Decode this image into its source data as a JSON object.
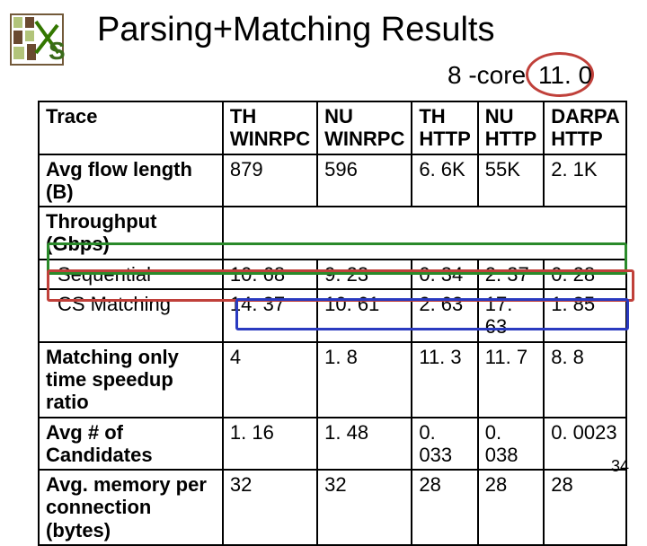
{
  "title": "Parsing+Matching Results",
  "subtitle_left": "8 -core",
  "subtitle_right": "11. 0",
  "headers": {
    "trace": "Trace",
    "c1": "TH WINRPC",
    "c2": "NU WINRPC",
    "c3": "TH HTTP",
    "c4": "NU HTTP",
    "c5": "DARPA HTTP"
  },
  "rows": {
    "avgflow": {
      "label": "Avg flow length (B)",
      "c1": "879",
      "c2": "596",
      "c3": "6. 6K",
      "c4": "55K",
      "c5": "2. 1K"
    },
    "throughput": {
      "label": "Throughput (Gbps)"
    },
    "sequential": {
      "label": "Sequential",
      "c1": "10. 68",
      "c2": "9. 23",
      "c3": "0. 34",
      "c4": "2. 37",
      "c5": "0. 28"
    },
    "csmatching": {
      "label": "CS Matching",
      "c1": "14. 37",
      "c2": "10. 61",
      "c3": "2. 63",
      "c4": "17. 63",
      "c5": "1. 85"
    },
    "speedup": {
      "label": "Matching only time speedup ratio",
      "c1": "4",
      "c2": "1. 8",
      "c3": "11. 3",
      "c4": "11. 7",
      "c5": "8. 8"
    },
    "avgcand": {
      "label": "Avg # of Candidates",
      "c1": "1. 16",
      "c2": "1. 48",
      "c3": "0. 033",
      "c4": "0. 038",
      "c5": "0. 0023"
    },
    "avgmem": {
      "label": "Avg. memory per connection (bytes)",
      "c1": "32",
      "c2": "32",
      "c3": "28",
      "c4": "28",
      "c5": "28"
    }
  },
  "slide_number": "34"
}
